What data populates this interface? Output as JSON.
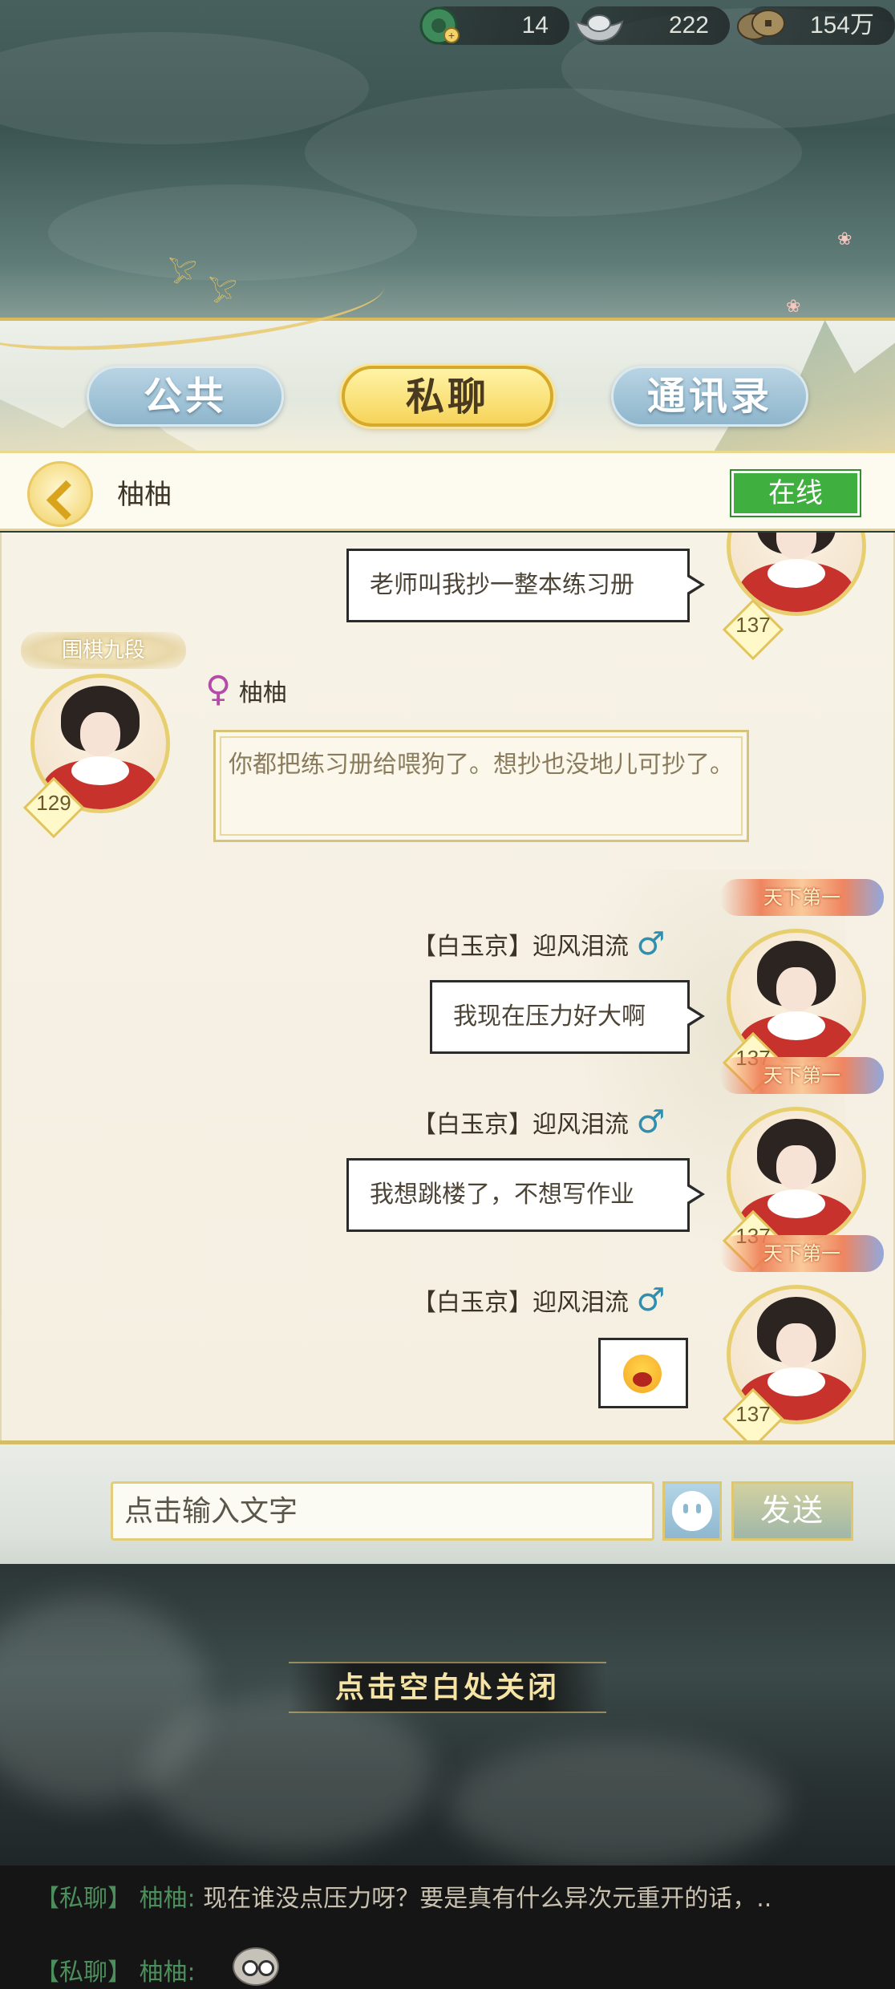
{
  "resources": [
    {
      "icon": "jade-coin-icon",
      "value": "14"
    },
    {
      "icon": "silver-ingot-icon",
      "value": "222"
    },
    {
      "icon": "copper-coins-icon",
      "value": "154万"
    }
  ],
  "tabs": [
    {
      "label": "公共",
      "active": false
    },
    {
      "label": "私聊",
      "active": true
    },
    {
      "label": "通讯录",
      "active": false
    }
  ],
  "chat_header": {
    "name": "柚柚",
    "status": "在线"
  },
  "messages": [
    {
      "side": "right",
      "text": "老师叫我抄一整本练习册",
      "level": "137"
    },
    {
      "side": "left",
      "title": "围棋九段",
      "sender": "柚柚",
      "gender_symbol": "♀",
      "text": "你都把练习册给喂狗了。想抄也没地儿可抄了。",
      "level": "129"
    },
    {
      "side": "right",
      "title": "天下第一",
      "sender": "【白玉京】迎风泪流",
      "gender_symbol": "♂",
      "text": "我现在压力好大啊",
      "level": "137"
    },
    {
      "side": "right",
      "title": "天下第一",
      "sender": "【白玉京】迎风泪流",
      "gender_symbol": "♂",
      "text": "我想跳楼了，不想写作业",
      "level": "137"
    },
    {
      "side": "right",
      "title": "天下第一",
      "sender": "【白玉京】迎风泪流",
      "gender_symbol": "♂",
      "emoji": "crying-laughing-emoji",
      "level": "137"
    }
  ],
  "input": {
    "placeholder": "点击输入文字",
    "send_label": "发送",
    "emoji_icon": "smiley-icon"
  },
  "close_hint": "点击空白处关闭",
  "log": [
    {
      "tag": "【私聊】",
      "name": "柚柚:",
      "text": "现在谁没点压力呀？要是真有什么异次元重开的话，.."
    },
    {
      "tag": "【私聊】",
      "name": "柚柚:",
      "text": "",
      "sticker": "crying-face-sticker"
    }
  ],
  "colors": {
    "accent_gold": "#f6d45a",
    "online_green": "#3faf3f",
    "tab_blue": "#8fb6cc",
    "male": "#2e8fb0",
    "female": "#b44ba9"
  }
}
